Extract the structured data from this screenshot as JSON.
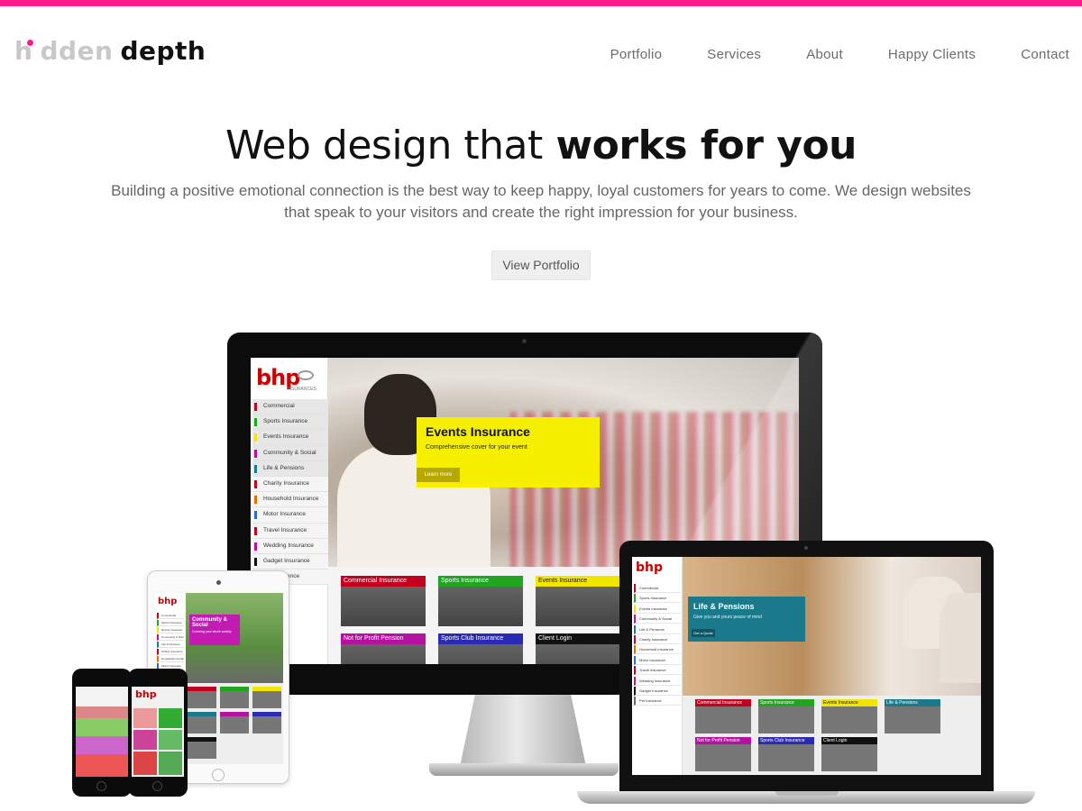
{
  "brand": {
    "logo_light": "hidden",
    "logo_dark": "depth",
    "accent_color": "#ff1a8c"
  },
  "nav": {
    "items": [
      "Portfolio",
      "Services",
      "About",
      "Happy Clients",
      "Contact"
    ]
  },
  "hero": {
    "title_light": "Web design that",
    "title_bold": "works for you",
    "subtitle": "Building a positive emotional connection is the best way to keep happy, loyal customers for years to come. We design websites that speak to your visitors and create the right impression for your business.",
    "cta_label": "View Portfolio"
  },
  "showcase": {
    "bhp_logo": "bhp",
    "bhp_logo_sub": "INSURANCES",
    "monitor_menu": [
      {
        "label": "Commercial",
        "color": "#c4001e"
      },
      {
        "label": "Sports Insurance",
        "color": "#1fa51f"
      },
      {
        "label": "Events Insurance",
        "color": "#f2e600"
      },
      {
        "label": "Community & Social",
        "color": "#b5109f"
      },
      {
        "label": "Life & Pensions",
        "color": "#1a7a8c"
      },
      {
        "label": "Charity Insurance",
        "color": "#c4001e"
      },
      {
        "label": "Household Insurance",
        "color": "#e07000"
      },
      {
        "label": "Motor Insurance",
        "color": "#2a6bd0"
      },
      {
        "label": "Travel Insurance",
        "color": "#c4001e"
      },
      {
        "label": "Wedding Insurance",
        "color": "#b5109f"
      },
      {
        "label": "Gadget Insurance",
        "color": "#111111"
      },
      {
        "label": "Pet Insurance",
        "color": "#666666"
      }
    ],
    "monitor_feature": {
      "title": "Events Insurance",
      "subtitle": "Comprehensive cover for your event",
      "button": "Learn more"
    },
    "monitor_tiles": [
      {
        "label": "Commercial Insurance",
        "color": "#c4001e",
        "style": "dark"
      },
      {
        "label": "Sports Insurance",
        "color": "#1fa51f",
        "style": "dark"
      },
      {
        "label": "Events Insurance",
        "color": "#f2e600",
        "style": "light"
      },
      {
        "label": "Not for Profit Pension",
        "color": "#b5109f",
        "style": "dark"
      },
      {
        "label": "Sports Club Insurance",
        "color": "#2a2ab5",
        "style": "dark"
      },
      {
        "label": "Client Login",
        "color": "#111111",
        "style": "dark"
      }
    ],
    "ipad_feature": {
      "title": "Community & Social",
      "subtitle": "Covering your whole society"
    },
    "laptop_feature": {
      "title": "Life & Pensions",
      "subtitle": "Give you and yours peace of mind",
      "button": "Get a Quote"
    },
    "laptop_tiles": [
      {
        "label": "Commercial Insurance",
        "color": "#c4001e",
        "style": "dark"
      },
      {
        "label": "Sports Insurance",
        "color": "#1fa51f",
        "style": "dark"
      },
      {
        "label": "Events Insurance",
        "color": "#f2e600",
        "style": "light"
      },
      {
        "label": "Life & Pensions",
        "color": "#1a7a8c",
        "style": "dark"
      },
      {
        "label": "Not for Profit Pension",
        "color": "#b5109f",
        "style": "dark"
      },
      {
        "label": "Sports Club Insurance",
        "color": "#2a2ab5",
        "style": "dark"
      },
      {
        "label": "Client Login",
        "color": "#111111",
        "style": "dark"
      }
    ]
  }
}
